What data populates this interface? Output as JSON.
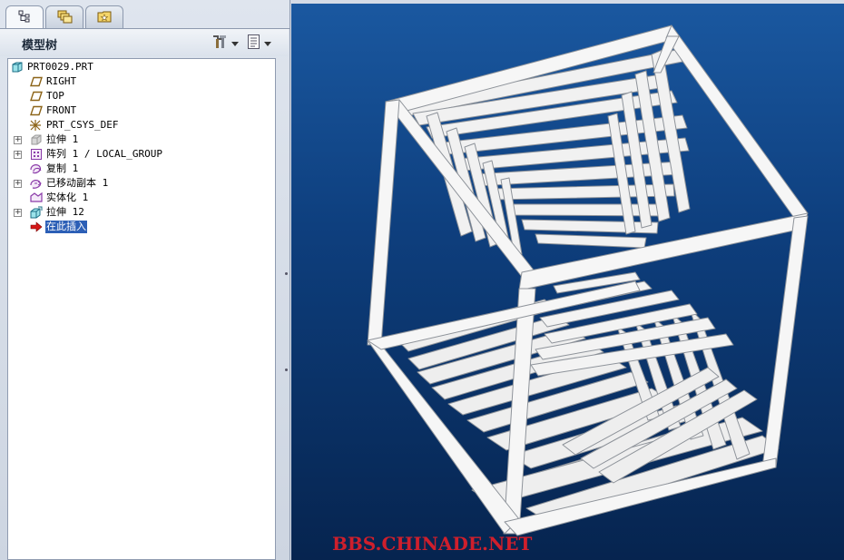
{
  "tabs": [
    {
      "name": "model-tree",
      "icon": "model-tree-icon"
    },
    {
      "name": "folder-browser",
      "icon": "folders-icon"
    },
    {
      "name": "favorites",
      "icon": "favorites-icon"
    }
  ],
  "tree_panel": {
    "title": "模型树",
    "settings_icon": "tools-icon",
    "show_icon": "list-icon"
  },
  "tree": [
    {
      "label": "PRT0029.PRT",
      "icon": "part-icon",
      "expander": false
    },
    {
      "label": "RIGHT",
      "icon": "datum-plane-icon",
      "expander": false
    },
    {
      "label": "TOP",
      "icon": "datum-plane-icon",
      "expander": false
    },
    {
      "label": "FRONT",
      "icon": "datum-plane-icon",
      "expander": false
    },
    {
      "label": "PRT_CSYS_DEF",
      "icon": "csys-icon",
      "expander": false
    },
    {
      "label": "拉伸 1",
      "icon": "extrude-icon",
      "expander": true
    },
    {
      "label": "阵列 1 / LOCAL_GROUP",
      "icon": "pattern-icon",
      "expander": true
    },
    {
      "label": "复制 1",
      "icon": "copy-icon",
      "expander": false
    },
    {
      "label": "已移动副本 1",
      "icon": "moved-copy-icon",
      "expander": true
    },
    {
      "label": "实体化 1",
      "icon": "solidify-icon",
      "expander": false
    },
    {
      "label": "拉伸 12",
      "icon": "extrude-icon",
      "expander": true
    },
    {
      "label": "在此插入",
      "icon": "insert-here-icon",
      "expander": false,
      "selected": true
    }
  ],
  "viewport": {
    "watermark": "BBS.CHINADE.NET",
    "background_top": "#1a58a0",
    "background_bottom": "#06244f",
    "frame_color": "#f2f2f2",
    "frame_shadow": "#9a9ea4"
  }
}
